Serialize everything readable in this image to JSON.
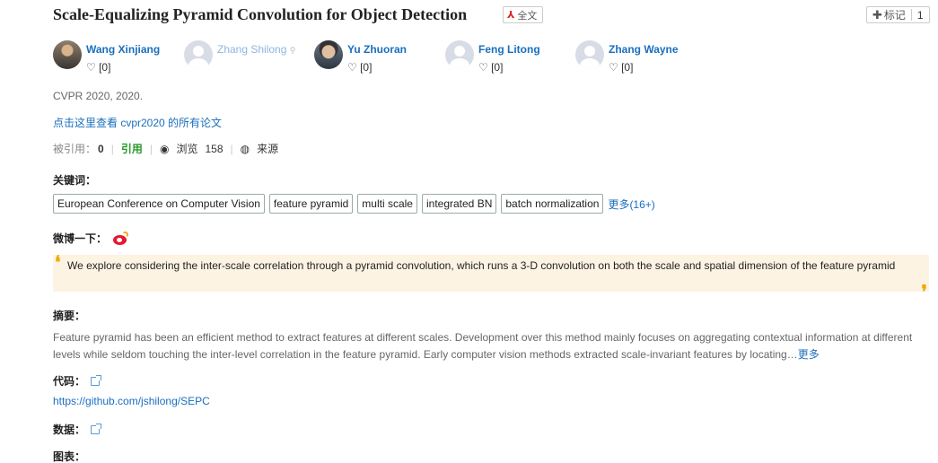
{
  "paper": {
    "title": "Scale-Equalizing Pyramid Convolution for Object Detection",
    "pdf_label": "全文",
    "mark_label": "标记",
    "mark_count": "1"
  },
  "authors": [
    {
      "name": "Wang Xinjiang",
      "likes": "[0]",
      "avatar": "photo"
    },
    {
      "name": "Zhang Shilong",
      "likes": "",
      "avatar": "blank"
    },
    {
      "name": "Yu Zhuoran",
      "likes": "[0]",
      "avatar": "photo"
    },
    {
      "name": "Feng Litong",
      "likes": "[0]",
      "avatar": "blank"
    },
    {
      "name": "Zhang Wayne",
      "likes": "[0]",
      "avatar": "blank"
    }
  ],
  "venue": "CVPR 2020, 2020.",
  "all_papers_link": "点击这里查看 cvpr2020 的所有论文",
  "stats": {
    "cited_label": "被引用：",
    "cited_count": "0",
    "cite_label": "引用",
    "views_label": "浏览",
    "views_count": "158",
    "source_label": "来源"
  },
  "keywords": {
    "label": "关键词：",
    "items": [
      "European Conference on Computer Vision",
      "feature pyramid",
      "multi scale",
      "integrated BN",
      "batch normalization"
    ],
    "more": "更多(16+)"
  },
  "weibo": {
    "label": "微博一下：",
    "quote": "We explore considering the inter-scale correlation through a pyramid convolution, which runs a 3-D convolution on both the scale and spatial dimension of the feature pyramid"
  },
  "abstract": {
    "label": "摘要：",
    "text": "Feature pyramid has been an efficient method to extract features at different scales. Development over this method mainly focuses on aggregating contextual information at different levels while seldom touching the inter-level correlation in the feature pyramid. Early computer vision methods extracted scale-invariant features by locating…",
    "more": "更多"
  },
  "code": {
    "label": "代码：",
    "link": "https://github.com/jshilong/SEPC"
  },
  "data_label": "数据：",
  "charts_label": "图表："
}
